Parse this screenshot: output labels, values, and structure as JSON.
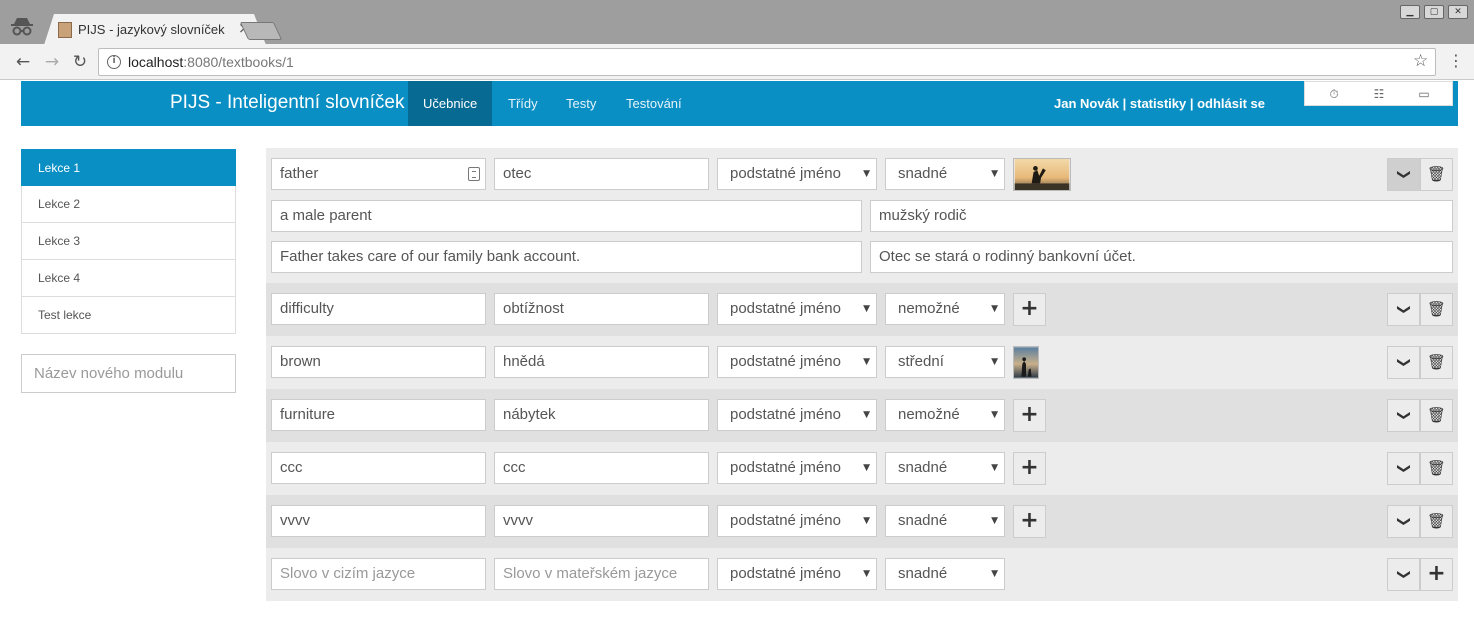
{
  "browser": {
    "tab_title": "PIJS - jazykový slovníček",
    "url_host": "localhost",
    "url_path": ":8080/textbooks/1"
  },
  "app": {
    "brand": "PIJS - Inteligentní slovníček",
    "nav": [
      "Učebnice",
      "Třídy",
      "Testy",
      "Testování"
    ],
    "active_nav": "Učebnice",
    "user_links": "Jan Novák | statistiky | odhlásit se",
    "accent_color": "#0a8fc4"
  },
  "sidebar": {
    "lessons": [
      "Lekce 1",
      "Lekce 2",
      "Lekce 3",
      "Lekce 4",
      "Test lekce"
    ],
    "active_lesson": "Lekce 1",
    "new_module_placeholder": "Název nového modulu"
  },
  "words": [
    {
      "foreign": "father",
      "native": "otec",
      "pos": "podstatné jméno",
      "difficulty": "snadné",
      "has_image": true,
      "expanded": true,
      "definition_foreign": "a male parent",
      "definition_native": "mužský rodič",
      "example_foreign": "Father takes care of our family bank account.",
      "example_native": "Otec se stará o rodinný bankovní účet."
    },
    {
      "foreign": "difficulty",
      "native": "obtížnost",
      "pos": "podstatné jméno",
      "difficulty": "nemožné",
      "has_image": false
    },
    {
      "foreign": "brown",
      "native": "hnědá",
      "pos": "podstatné jméno",
      "difficulty": "střední",
      "has_image": true
    },
    {
      "foreign": "furniture",
      "native": "nábytek",
      "pos": "podstatné jméno",
      "difficulty": "nemožné",
      "has_image": false
    },
    {
      "foreign": "ccc",
      "native": "ccc",
      "pos": "podstatné jméno",
      "difficulty": "snadné",
      "has_image": false
    },
    {
      "foreign": "vvvv",
      "native": "vvvv",
      "pos": "podstatné jméno",
      "difficulty": "snadné",
      "has_image": false
    }
  ],
  "new_word": {
    "foreign_placeholder": "Slovo v cizím jazyce",
    "native_placeholder": "Slovo v mateřském jazyce",
    "pos": "podstatné jméno",
    "difficulty": "snadné"
  },
  "icons": {
    "caret": "▼",
    "chevron": "❯",
    "trash": "🗑",
    "plus": "+"
  }
}
